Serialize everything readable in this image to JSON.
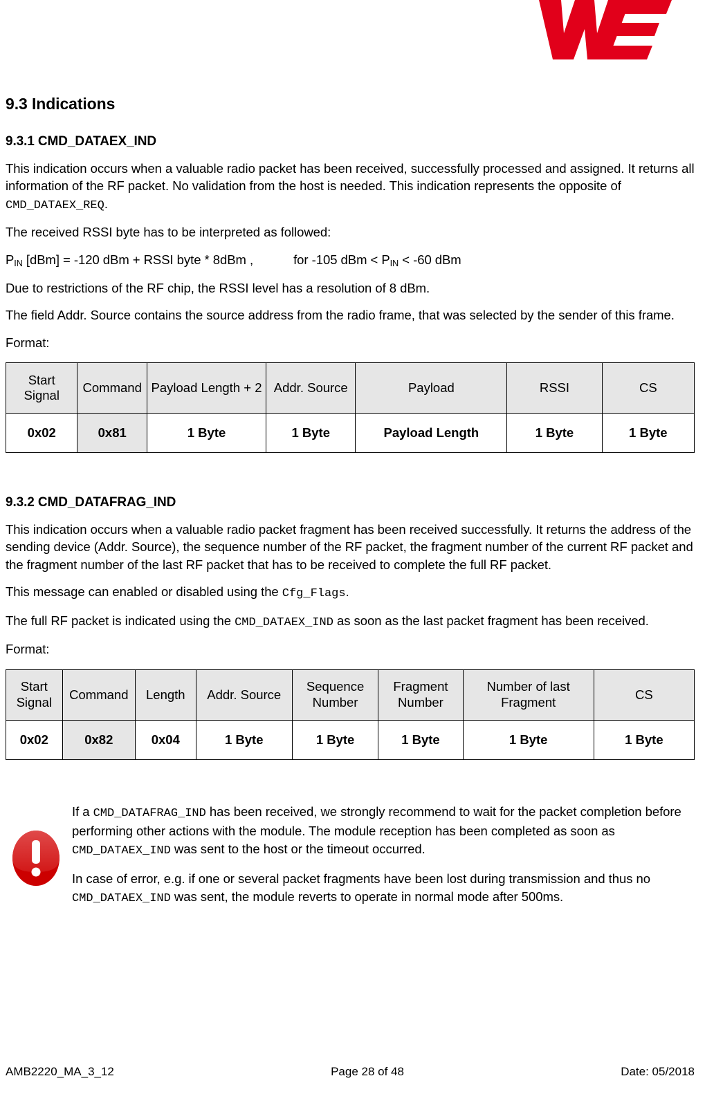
{
  "brand": {
    "logo_name": "we-logo",
    "logo_color": "#E1001A"
  },
  "section": {
    "number_title": "9.3 Indications",
    "subsections": [
      {
        "heading": "9.3.1 CMD_DATAEX_IND",
        "paragraphs": [
          {
            "parts": [
              {
                "type": "text",
                "value": "This indication occurs when a valuable radio packet has been received, successfully processed and assigned. It returns all information of the RF packet. No validation from the host is needed. This indication represents the opposite of "
              },
              {
                "type": "code",
                "value": "CMD_DATAEX_REQ"
              },
              {
                "type": "text",
                "value": "."
              }
            ]
          },
          {
            "parts": [
              {
                "type": "text",
                "value": "The received RSSI byte has to be interpreted as followed:"
              }
            ]
          }
        ],
        "formula": {
          "lhs_symbol": "P",
          "lhs_subscript": "IN",
          "lhs_rest": " [dBm] = -120 dBm + RSSI byte * 8dBm  ,",
          "rhs_prefix": "for -105 dBm < ",
          "rhs_symbol": "P",
          "rhs_subscript": "IN",
          "rhs_rest": " < -60 dBm"
        },
        "after_formula": [
          "Due to restrictions of the RF chip, the RSSI level has a resolution of 8 dBm.",
          "The field Addr. Source contains the source address from the radio frame, that was selected by the sender of this frame."
        ],
        "format_label": "Format:",
        "table": {
          "columns": [
            "Start Signal",
            "Command",
            "Payload Length + 2",
            "Addr. Source",
            "Payload",
            "RSSI",
            "CS"
          ],
          "values": [
            "0x02",
            "0x81",
            "1 Byte",
            "1 Byte",
            "Payload Length",
            "1 Byte",
            "1 Byte"
          ],
          "shaded_value_index": 1,
          "col_widths": [
            "10.4%",
            "10.1%",
            "17.3%",
            "13.0%",
            "22.0%",
            "13.8%",
            "13.4%"
          ]
        }
      },
      {
        "heading": "9.3.2 CMD_DATAFRAG_IND",
        "paragraphs": [
          {
            "parts": [
              {
                "type": "text",
                "value": "This indication occurs when a valuable radio packet fragment has been received successfully. It returns the address of the sending device (Addr. Source), the sequence number of the RF packet, the fragment number of the current RF packet and the fragment number of the last RF packet that has to be received to complete the full RF packet."
              }
            ]
          },
          {
            "parts": [
              {
                "type": "text",
                "value": "This message can enabled or disabled using the "
              },
              {
                "type": "code",
                "value": "Cfg_Flags"
              },
              {
                "type": "text",
                "value": "."
              }
            ]
          },
          {
            "parts": [
              {
                "type": "text",
                "value": "The full RF packet is indicated using the "
              },
              {
                "type": "code",
                "value": "CMD_DATAEX_IND"
              },
              {
                "type": "text",
                "value": " as soon as the last packet fragment has been received."
              }
            ]
          }
        ],
        "format_label": "Format:",
        "table": {
          "columns": [
            "Start Signal",
            "Command",
            "Length",
            "Addr. Source",
            "Sequence Number",
            "Fragment Number",
            "Number of last Fragment",
            "CS"
          ],
          "values": [
            "0x02",
            "0x82",
            "0x04",
            "1 Byte",
            "1 Byte",
            "1 Byte",
            "1 Byte",
            "1 Byte"
          ],
          "shaded_value_index": 1,
          "col_widths": [
            "8.2%",
            "10.6%",
            "8.8%",
            "14.0%",
            "12.5%",
            "12.3%",
            "19.0%",
            "14.6%"
          ]
        }
      }
    ]
  },
  "note": {
    "icon_name": "warning-exclamation-icon",
    "icon_color": "#CC0000",
    "paragraphs": [
      {
        "parts": [
          {
            "type": "text",
            "value": "If a "
          },
          {
            "type": "code",
            "value": "CMD_DATAFRAG_IND"
          },
          {
            "type": "text",
            "value": " has been received, we strongly recommend to wait for the packet completion before performing other actions with the module. The module reception has been completed as soon as "
          },
          {
            "type": "code",
            "value": "CMD_DATAEX_IND"
          },
          {
            "type": "text",
            "value": "  was sent to the host or the timeout occurred."
          }
        ]
      },
      {
        "parts": [
          {
            "type": "text",
            "value": "In case of error, e.g. if one or several packet fragments have been lost during transmission and thus no "
          },
          {
            "type": "code",
            "value": "CMD_DATAEX_IND"
          },
          {
            "type": "text",
            "value": "  was sent, the module reverts to operate in normal mode after 500ms."
          }
        ]
      }
    ]
  },
  "footer": {
    "doc_id": "AMB2220_MA_3_12",
    "page": "Page 28 of 48",
    "date": "Date: 05/2018"
  }
}
